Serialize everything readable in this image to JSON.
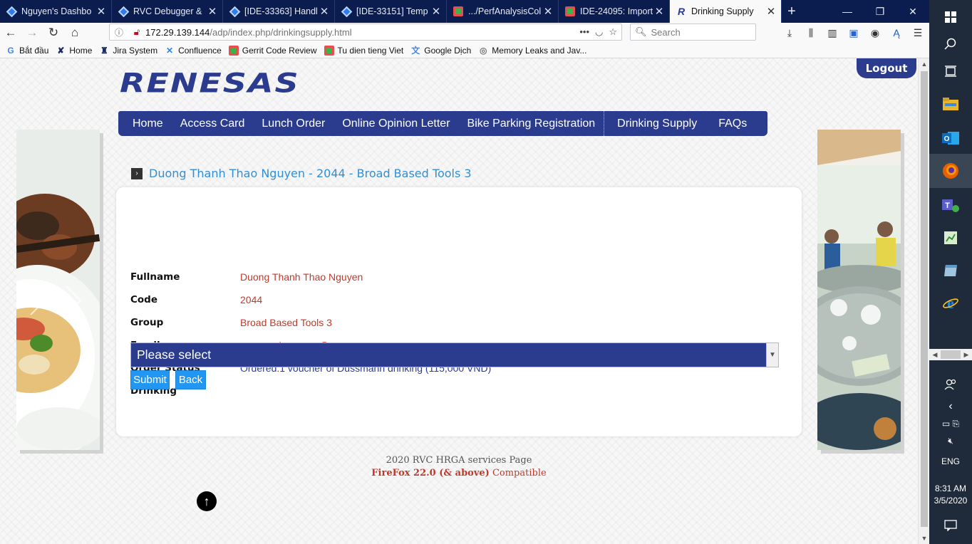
{
  "browser": {
    "tabs": [
      {
        "label": "Nguyen's Dashbo",
        "icon": "jira-diamond-icon"
      },
      {
        "label": "RVC Debugger &",
        "icon": "jira-diamond-icon"
      },
      {
        "label": "[IDE-33363] Handl",
        "icon": "jira-diamond-icon"
      },
      {
        "label": "[IDE-33151] Temp",
        "icon": "jira-diamond-icon"
      },
      {
        "label": ".../PerfAnalysisCol",
        "icon": "gerrit-icon"
      },
      {
        "label": "IDE-24095: Import",
        "icon": "gerrit-icon"
      },
      {
        "label": "Drinking Supply",
        "icon": "renesas-icon"
      }
    ],
    "address": {
      "host": "172.29.139.144",
      "path": "/adp/index.php/drinkingsupply.html"
    },
    "search_placeholder": "Search",
    "bookmarks": [
      {
        "label": "Bắt đầu",
        "icon": "google-icon"
      },
      {
        "label": "Home",
        "icon": "x-icon"
      },
      {
        "label": "Jira System",
        "icon": "jira-icon"
      },
      {
        "label": "Confluence",
        "icon": "confluence-icon"
      },
      {
        "label": "Gerrit Code Review",
        "icon": "gerrit-icon"
      },
      {
        "label": "Tu dien tieng Viet",
        "icon": "gerrit-icon"
      },
      {
        "label": "Google Dịch",
        "icon": "translate-icon"
      },
      {
        "label": "Memory Leaks and Jav...",
        "icon": "globe-icon"
      }
    ]
  },
  "page": {
    "logout_label": "Logout",
    "logo_text": "RENESAS",
    "nav": [
      "Home",
      "Access Card",
      "Lunch Order",
      "Online Opinion Letter",
      "Bike Parking Registration",
      "Drinking Supply",
      "FAQs"
    ],
    "heading": "Duong Thanh Thao Nguyen - 2044 - Broad Based Tools 3",
    "fields": [
      {
        "label": "Fullname",
        "value": "Duong Thanh Thao Nguyen"
      },
      {
        "label": "Code",
        "value": "2044"
      },
      {
        "label": "Group",
        "value": "Broad Based Tools 3"
      },
      {
        "label": "Email",
        "value": "nguyen.duong.uw@renesas.com"
      },
      {
        "label": "Order Status",
        "value": "Ordered:1 voucher of Dussmann drinking (115,000 VND)"
      },
      {
        "label": "Drinking",
        "value": ""
      }
    ],
    "drinking_select": "Please select",
    "submit_label": "Submit",
    "back_label": "Back",
    "footer_line1": "2020 RVC HRGA services Page",
    "footer_line2_bold": "FireFox 22.0 (& above)",
    "footer_line2_rest": " Compatible"
  },
  "taskbar": {
    "language": "ENG",
    "time": "8:31 AM",
    "date": "3/5/2020"
  },
  "colors": {
    "brand": "#2b3c8f",
    "value_text": "#c0392b",
    "heading_text": "#2f8fd8",
    "button": "#2196f3"
  }
}
